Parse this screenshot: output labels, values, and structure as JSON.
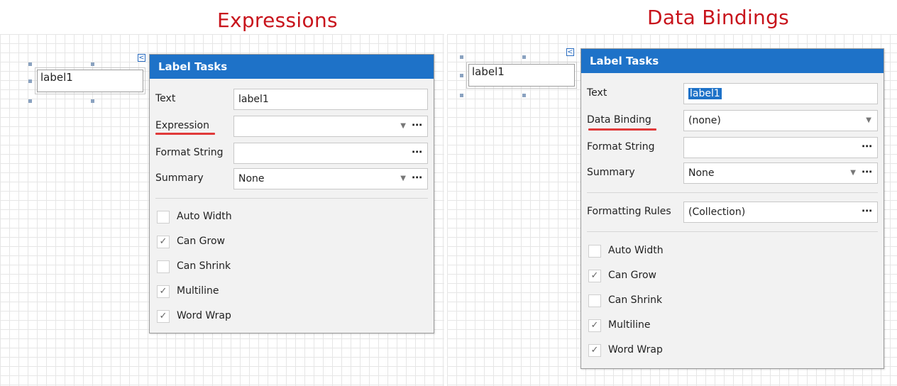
{
  "titles": {
    "left": "Expressions",
    "right": "Data Bindings"
  },
  "left": {
    "label_text": "label1",
    "panel": {
      "header": "Label Tasks",
      "text": {
        "label": "Text",
        "value": "label1"
      },
      "expression": {
        "label": "Expression",
        "value": ""
      },
      "format_string": {
        "label": "Format String",
        "value": ""
      },
      "summary": {
        "label": "Summary",
        "value": "None"
      },
      "checkboxes": [
        {
          "label": "Auto Width",
          "checked": false
        },
        {
          "label": "Can Grow",
          "checked": true
        },
        {
          "label": "Can Shrink",
          "checked": false
        },
        {
          "label": "Multiline",
          "checked": true
        },
        {
          "label": "Word Wrap",
          "checked": true
        }
      ]
    }
  },
  "right": {
    "label_text": "label1",
    "panel": {
      "header": "Label Tasks",
      "text": {
        "label": "Text",
        "value": "label1"
      },
      "data_binding": {
        "label": "Data Binding",
        "value": "(none)"
      },
      "format_string": {
        "label": "Format String",
        "value": ""
      },
      "summary": {
        "label": "Summary",
        "value": "None"
      },
      "formatting_rules": {
        "label": "Formatting Rules",
        "value": "(Collection)"
      },
      "checkboxes": [
        {
          "label": "Auto Width",
          "checked": false
        },
        {
          "label": "Can Grow",
          "checked": true
        },
        {
          "label": "Can Shrink",
          "checked": false
        },
        {
          "label": "Multiline",
          "checked": true
        },
        {
          "label": "Word Wrap",
          "checked": true
        }
      ]
    }
  },
  "glyphs": {
    "ellipsis": "⋯",
    "arrow": "▼",
    "check": "✓",
    "smart_tag": "<"
  },
  "colors": {
    "title": "#c8141c",
    "header": "#1e72c8",
    "underline": "#e03a3a"
  }
}
